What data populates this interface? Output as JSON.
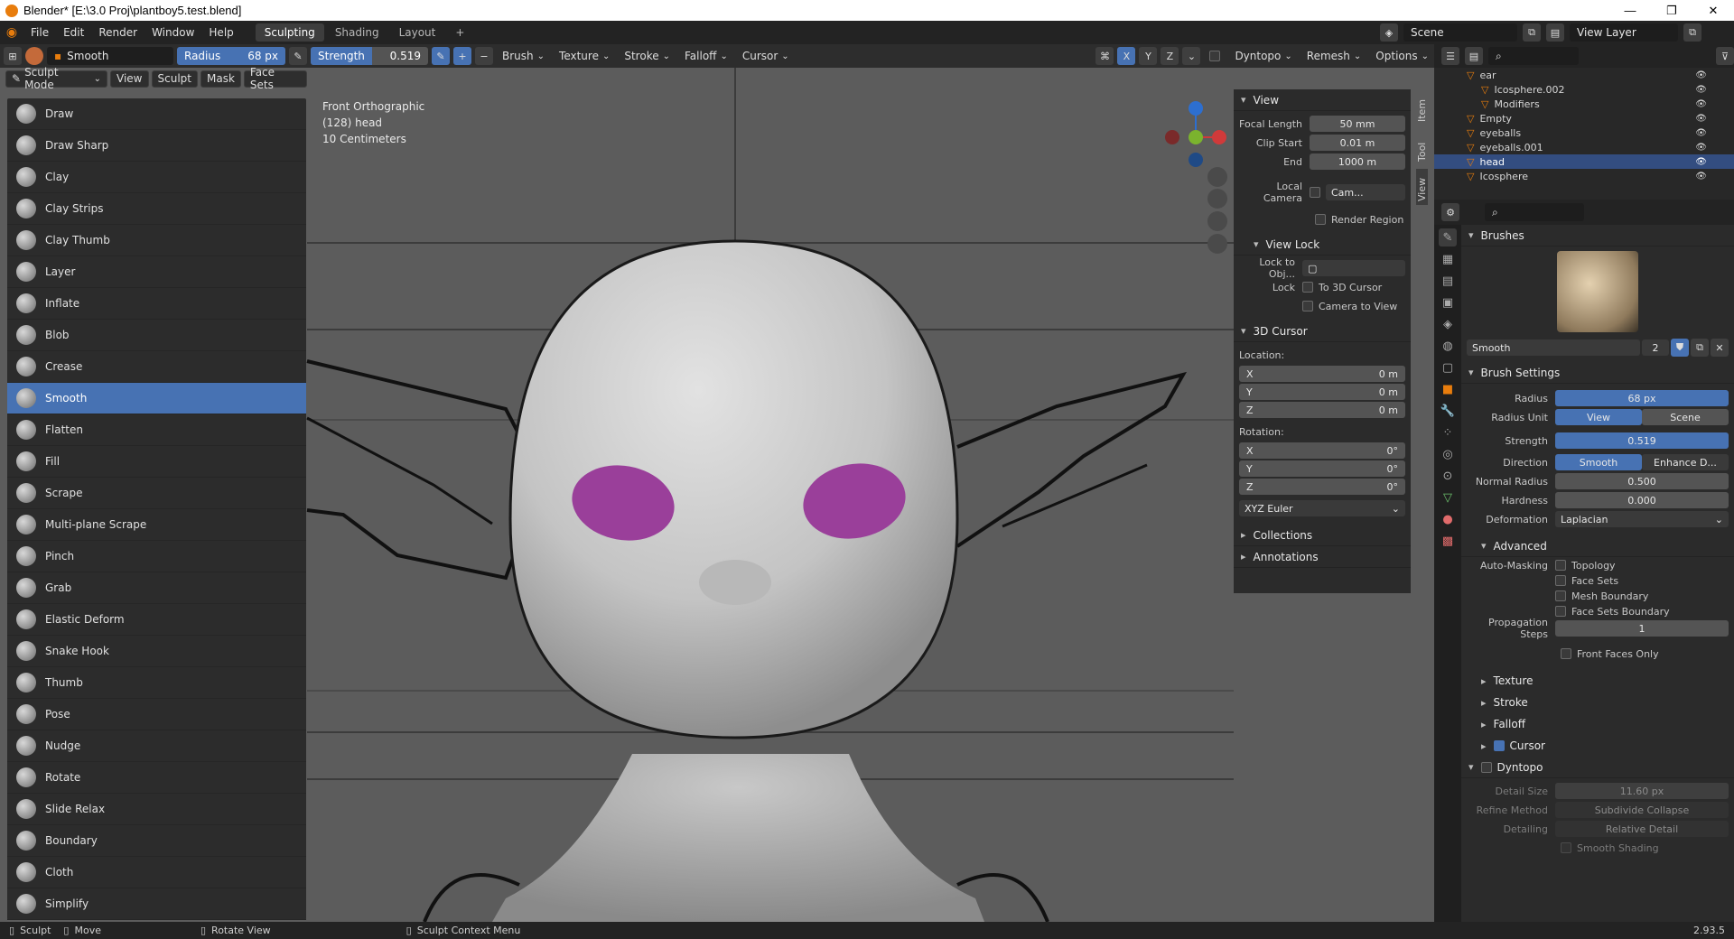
{
  "window": {
    "title": "Blender* [E:\\3.0 Proj\\plantboy5.test.blend]",
    "min": "—",
    "max": "❐",
    "close": "✕"
  },
  "menu": {
    "items": [
      "File",
      "Edit",
      "Render",
      "Window",
      "Help"
    ],
    "workspaces": [
      "Sculpting",
      "Shading",
      "Layout"
    ],
    "add": "+",
    "scene": "Scene",
    "view_layer": "View Layer"
  },
  "toolhdr": {
    "brush_name": "Smooth",
    "radius_label": "Radius",
    "radius_value": "68 px",
    "strength_label": "Strength",
    "strength_value": "0.519",
    "menus": [
      "Brush",
      "Texture",
      "Stroke",
      "Falloff",
      "Cursor"
    ],
    "axes": [
      "X",
      "Y",
      "Z"
    ],
    "dyntopo": "Dyntopo",
    "remesh": "Remesh",
    "options": "Options"
  },
  "modehdr": {
    "mode": "Sculpt Mode",
    "items": [
      "View",
      "Sculpt",
      "Mask",
      "Face Sets"
    ]
  },
  "viewport": {
    "line1": "Front Orthographic",
    "line2": "(128) head",
    "line3": "10 Centimeters"
  },
  "tools": [
    "Draw",
    "Draw Sharp",
    "Clay",
    "Clay Strips",
    "Clay Thumb",
    "Layer",
    "Inflate",
    "Blob",
    "Crease",
    "Smooth",
    "Flatten",
    "Fill",
    "Scrape",
    "Multi-plane Scrape",
    "Pinch",
    "Grab",
    "Elastic Deform",
    "Snake Hook",
    "Thumb",
    "Pose",
    "Nudge",
    "Rotate",
    "Slide Relax",
    "Boundary",
    "Cloth",
    "Simplify"
  ],
  "active_tool": "Smooth",
  "npanel": {
    "view_title": "View",
    "focal_label": "Focal Length",
    "focal": "50 mm",
    "clip_start_label": "Clip Start",
    "clip_start": "0.01 m",
    "end_label": "End",
    "end": "1000 m",
    "local_camera": "Local Camera",
    "camera": "Cam...",
    "render_region": "Render Region",
    "view_lock": "View Lock",
    "lock_to_obj": "Lock to Obj...",
    "lock": "Lock",
    "to_3d_cursor": "To 3D Cursor",
    "camera_to_view": "Camera to View",
    "cursor_title": "3D Cursor",
    "location": "Location:",
    "loc": [
      [
        "X",
        "0 m"
      ],
      [
        "Y",
        "0 m"
      ],
      [
        "Z",
        "0 m"
      ]
    ],
    "rotation": "Rotation:",
    "rot": [
      [
        "X",
        "0°"
      ],
      [
        "Y",
        "0°"
      ],
      [
        "Z",
        "0°"
      ]
    ],
    "euler": "XYZ Euler",
    "collections": "Collections",
    "annotations": "Annotations",
    "tabs": [
      "Item",
      "Tool",
      "View"
    ]
  },
  "outliner": {
    "rows": [
      {
        "name": "ear",
        "indent": 1
      },
      {
        "name": "Icosphere.002",
        "indent": 2
      },
      {
        "name": "Modifiers",
        "indent": 2
      },
      {
        "name": "Empty",
        "indent": 1
      },
      {
        "name": "eyeballs",
        "indent": 1
      },
      {
        "name": "eyeballs.001",
        "indent": 1
      },
      {
        "name": "head",
        "indent": 1,
        "selected": true
      },
      {
        "name": "Icosphere",
        "indent": 1
      }
    ]
  },
  "props": {
    "brushes": "Brushes",
    "brush_name": "Smooth",
    "brush_users": "2",
    "brush_settings": "Brush Settings",
    "radius_label": "Radius",
    "radius": "68 px",
    "radius_unit_label": "Radius Unit",
    "view": "View",
    "scene": "Scene",
    "strength_label": "Strength",
    "strength": "0.519",
    "direction_label": "Direction",
    "dir_smooth": "Smooth",
    "dir_enhance": "Enhance D...",
    "normal_radius_label": "Normal Radius",
    "normal_radius": "0.500",
    "hardness_label": "Hardness",
    "hardness": "0.000",
    "deformation_label": "Deformation",
    "deformation": "Laplacian",
    "advanced": "Advanced",
    "automasking_label": "Auto-Masking",
    "automask": [
      "Topology",
      "Face Sets",
      "Mesh Boundary",
      "Face Sets Boundary"
    ],
    "prop_steps_label": "Propagation Steps",
    "prop_steps": "1",
    "front_faces": "Front Faces Only",
    "texture": "Texture",
    "stroke": "Stroke",
    "falloff": "Falloff",
    "cursor": "Cursor",
    "dyntopo": "Dyntopo",
    "detail_size_label": "Detail Size",
    "detail_size": "11.60 px",
    "refine_label": "Refine Method",
    "refine": "Subdivide Collapse",
    "detailing_label": "Detailing",
    "detailing": "Relative Detail",
    "smooth_shading": "Smooth Shading"
  },
  "status": {
    "sculpt": "Sculpt",
    "move": "Move",
    "rotate": "Rotate View",
    "context": "Sculpt Context Menu",
    "version": "2.93.5"
  },
  "colors": {
    "accent": "#4772b3",
    "eyes": "#9a3f9a",
    "head": "#cfcfcf"
  }
}
